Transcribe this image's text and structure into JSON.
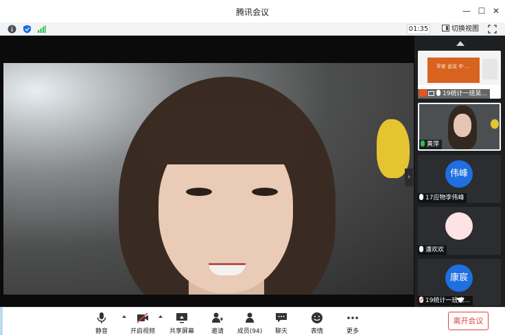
{
  "window": {
    "title": "腾讯会议"
  },
  "infobar": {
    "timer": "01:35",
    "switch_view_label": "切换视图"
  },
  "participants": [
    {
      "name": "19统计一班吴...",
      "mic": "on",
      "sharing": true,
      "avatar_text": ""
    },
    {
      "name": "黄萍",
      "mic": "active",
      "sharing": false,
      "avatar_text": ""
    },
    {
      "name": "17应物李伟峰",
      "mic": "on",
      "sharing": false,
      "avatar_text": "伟峰",
      "avatar_color": "#1e6fe0"
    },
    {
      "name": "潘欢欢",
      "mic": "on",
      "sharing": false,
      "avatar_text": "",
      "avatar_color": "#fde3e3"
    },
    {
      "name": "19统计一班康...",
      "mic": "muted",
      "sharing": false,
      "avatar_text": "康宸",
      "avatar_color": "#1e6fe0"
    }
  ],
  "shared_slide": {
    "text": "平安 会议 中 ..."
  },
  "toolbar": {
    "mute_label": "静音",
    "video_label": "开启视频",
    "share_label": "共享屏幕",
    "invite_label": "邀请",
    "members_label": "成员(94)",
    "chat_label": "聊天",
    "emoji_label": "表情",
    "more_label": "更多",
    "leave_label": "离开会议"
  },
  "colors": {
    "accent": "#1e6fe0",
    "danger": "#e0423c",
    "mic_active": "#2fbf4c",
    "signal": "#2fbf4c"
  }
}
